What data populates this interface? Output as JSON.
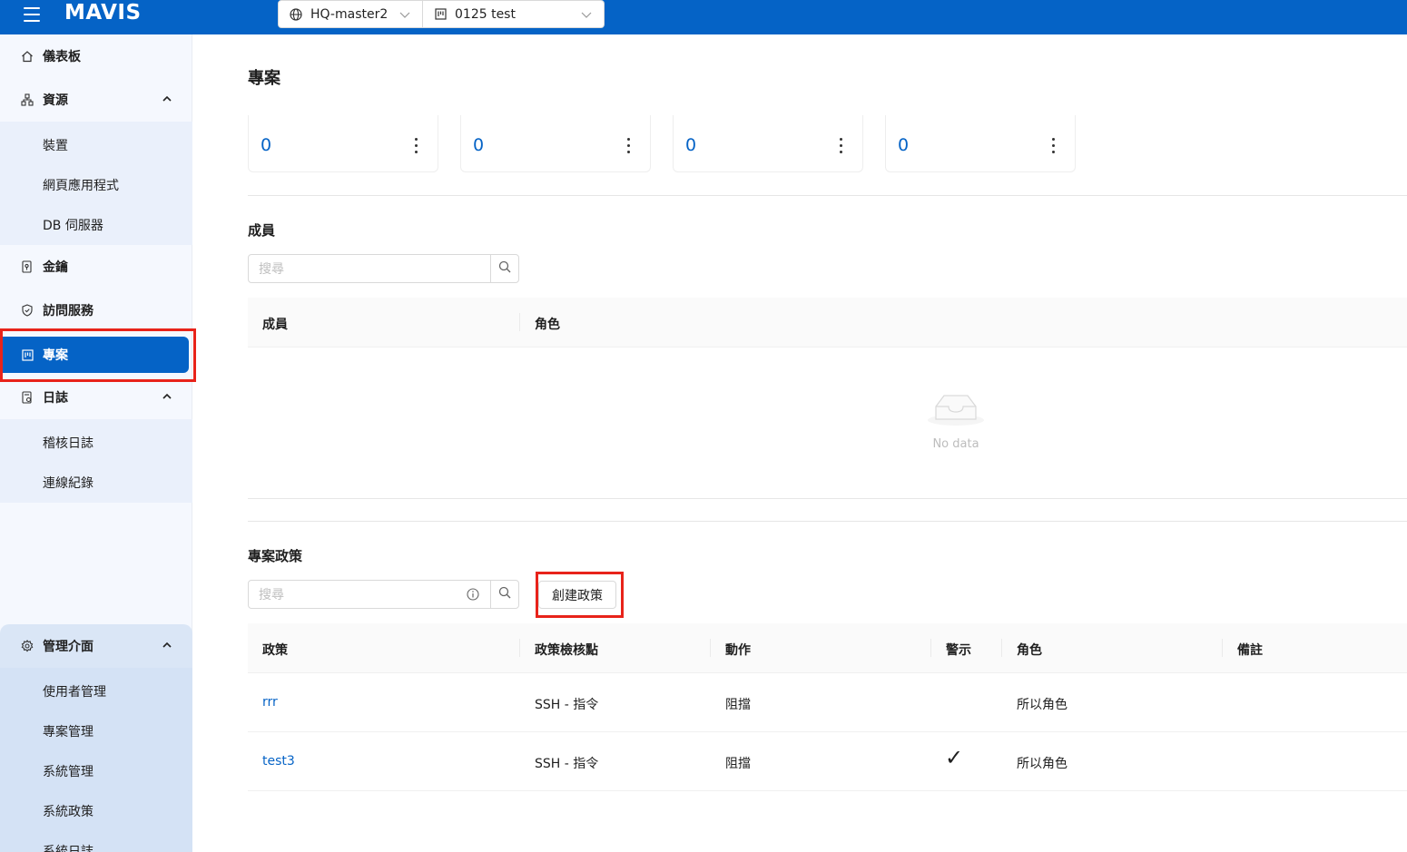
{
  "app": {
    "logo": "MAVIS",
    "region_select": "HQ-master2",
    "project_select": "0125 test"
  },
  "sidebar": {
    "dashboard": "儀表板",
    "resources": "資源",
    "resources_items": [
      "裝置",
      "網頁應用程式",
      "DB 伺服器"
    ],
    "keys": "金鑰",
    "access_service": "訪問服務",
    "projects": "專案",
    "logs": "日誌",
    "logs_items": [
      "稽核日誌",
      "連線紀錄"
    ],
    "admin": "管理介面",
    "admin_items": [
      "使用者管理",
      "專案管理",
      "系統管理",
      "系統政策",
      "系統日誌"
    ]
  },
  "main": {
    "title": "專案",
    "stats": [
      "0",
      "0",
      "0",
      "0"
    ],
    "members": {
      "title": "成員",
      "search_placeholder": "搜尋",
      "columns": [
        "成員",
        "角色"
      ],
      "empty_text": "No data"
    },
    "policies": {
      "title": "專案政策",
      "search_placeholder": "搜尋",
      "create_button": "創建政策",
      "columns": [
        "政策",
        "政策檢核點",
        "動作",
        "警示",
        "角色",
        "備註"
      ],
      "rows": [
        {
          "name": "rrr",
          "checkpoint": "SSH - 指令",
          "action": "阻擋",
          "alert": "",
          "role": "所以角色",
          "note": ""
        },
        {
          "name": "test3",
          "checkpoint": "SSH - 指令",
          "action": "阻擋",
          "alert": "✓",
          "role": "所以角色",
          "note": ""
        }
      ]
    }
  }
}
